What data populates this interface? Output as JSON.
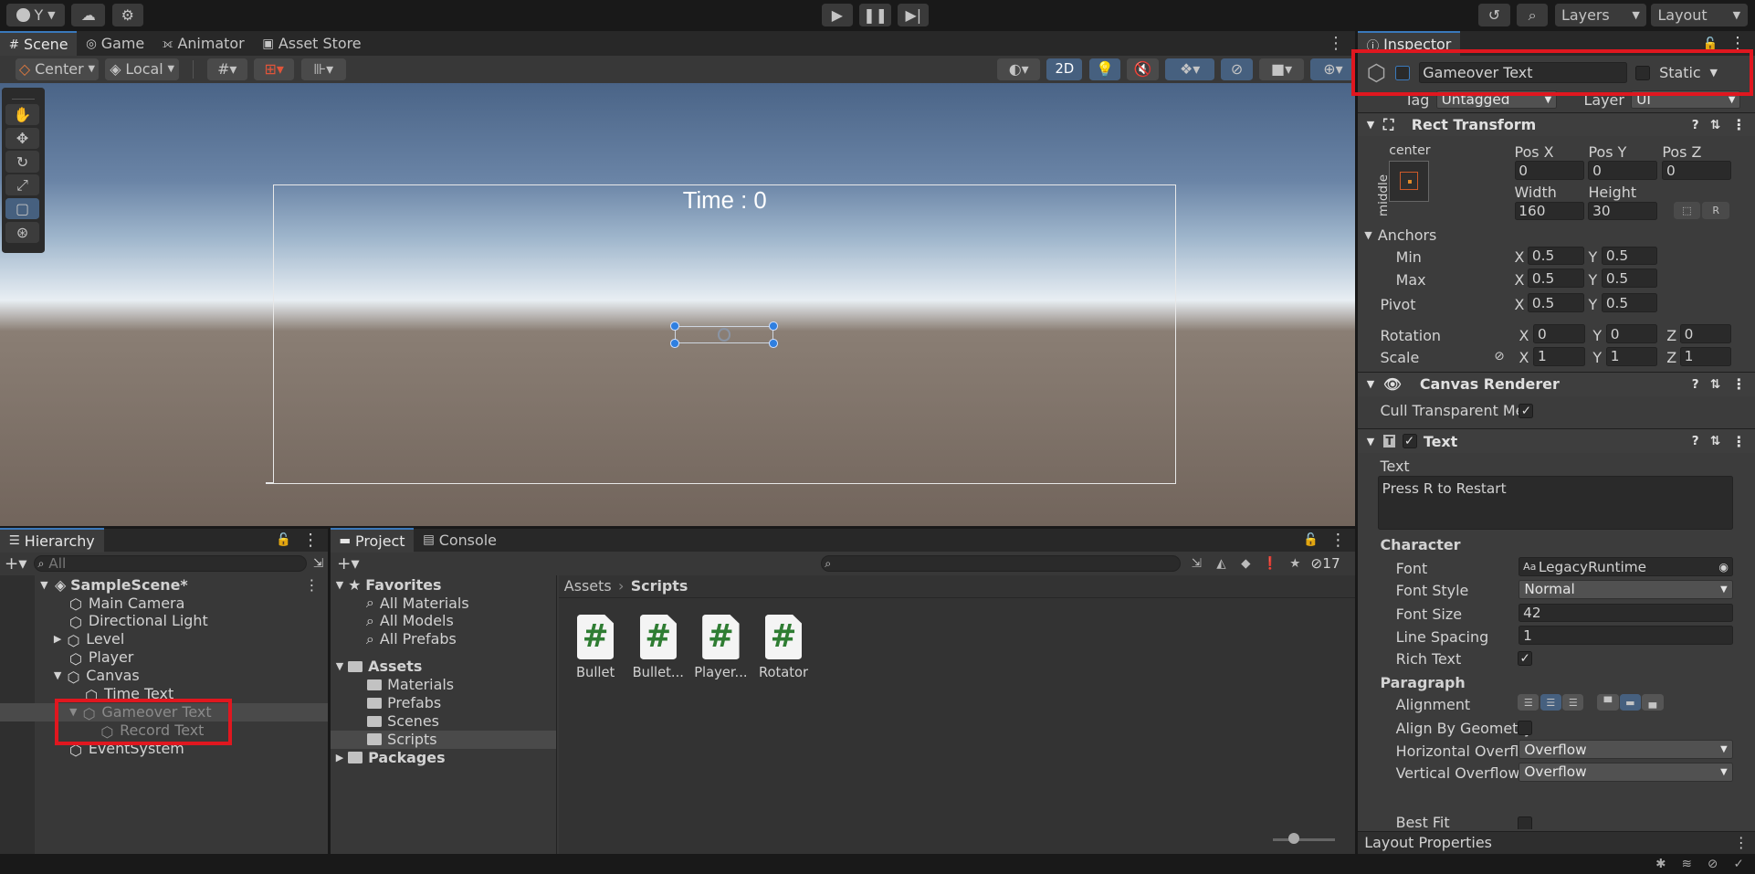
{
  "toolbar": {
    "account_label": "Y",
    "layers_label": "Layers",
    "layout_label": "Layout"
  },
  "scene_tabs": [
    "Scene",
    "Game",
    "Animator",
    "Asset Store"
  ],
  "scene_toolbar": {
    "pivot_label": "Center",
    "space_label": "Local",
    "mode_2d": "2D"
  },
  "scene": {
    "time_text": "Time : 0"
  },
  "inspector": {
    "tab_label": "Inspector",
    "object_name": "Gameover Text",
    "static_label": "Static",
    "tag_label": "Tag",
    "tag_value": "Untagged",
    "layer_label": "Layer",
    "layer_value": "UI",
    "rect_transform": {
      "title": "Rect Transform",
      "anchor_h": "center",
      "anchor_v": "middle",
      "pos_x_label": "Pos X",
      "pos_y_label": "Pos Y",
      "pos_z_label": "Pos Z",
      "pos_x": "0",
      "pos_y": "0",
      "pos_z": "0",
      "width_label": "Width",
      "height_label": "Height",
      "width": "160",
      "height": "30",
      "anchors_label": "Anchors",
      "min_label": "Min",
      "max_label": "Max",
      "min_x": "0.5",
      "min_y": "0.5",
      "max_x": "0.5",
      "max_y": "0.5",
      "pivot_label": "Pivot",
      "pivot_x": "0.5",
      "pivot_y": "0.5",
      "rotation_label": "Rotation",
      "rot_x": "0",
      "rot_y": "0",
      "rot_z": "0",
      "scale_label": "Scale",
      "scale_x": "1",
      "scale_y": "1",
      "scale_z": "1",
      "x": "X",
      "y": "Y",
      "z": "Z"
    },
    "canvas_renderer": {
      "title": "Canvas Renderer",
      "cull_label": "Cull Transparent Mes"
    },
    "text": {
      "title": "Text",
      "text_label": "Text",
      "text_value": "Press R to Restart",
      "character_label": "Character",
      "font_label": "Font",
      "font_value": "LegacyRuntime",
      "font_style_label": "Font Style",
      "font_style_value": "Normal",
      "font_size_label": "Font Size",
      "font_size_value": "42",
      "line_spacing_label": "Line Spacing",
      "line_spacing_value": "1",
      "rich_text_label": "Rich Text",
      "paragraph_label": "Paragraph",
      "alignment_label": "Alignment",
      "align_geometry_label": "Align By Geometry",
      "h_overflow_label": "Horizontal Overflo",
      "h_overflow_value": "Overflow",
      "v_overflow_label": "Vertical Overflow",
      "v_overflow_value": "Overflow",
      "best_fit_label": "Best Fit"
    },
    "layout_properties": "Layout Properties"
  },
  "hierarchy": {
    "tab_label": "Hierarchy",
    "search_placeholder": "All",
    "scene_name": "SampleScene*",
    "items": [
      "Main Camera",
      "Directional Light",
      "Level",
      "Player",
      "Canvas",
      "Time Text",
      "Gameover Text",
      "Record Text",
      "EventSystem"
    ]
  },
  "project": {
    "tab_label": "Project",
    "console_label": "Console",
    "hidden_count": "17",
    "favorites_label": "Favorites",
    "favorites": [
      "All Materials",
      "All Models",
      "All Prefabs"
    ],
    "assets_label": "Assets",
    "folders": [
      "Materials",
      "Prefabs",
      "Scenes",
      "Scripts"
    ],
    "packages_label": "Packages",
    "breadcrumb": [
      "Assets",
      "Scripts"
    ],
    "files": [
      "Bullet",
      "Bullet...",
      "Player...",
      "Rotator"
    ],
    "file_glyph": "#"
  },
  "colors": {
    "accent": "#3a79bb",
    "highlight": "#e0171f",
    "script_green": "#2f7d33"
  }
}
